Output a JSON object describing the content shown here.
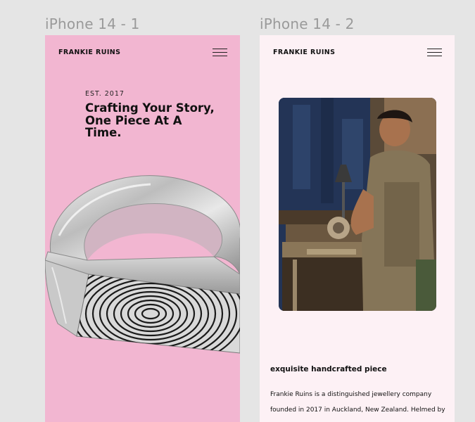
{
  "frames": [
    {
      "label": "iPhone 14 - 1",
      "background": "#f2b6d1",
      "brand": "FRANKIE RUINS",
      "est": "EST. 2017",
      "title_lines": [
        "Crafting Your Story,",
        "One Piece At A",
        "Time."
      ]
    },
    {
      "label": "iPhone 14 - 2",
      "background": "#fdf1f5",
      "brand": "FRANKIE RUINS",
      "subheading": "exquisite handcrafted piece",
      "body_lines": [
        "Frankie Ruins is a distinguished jewellery company",
        "founded in 2017 in Auckland, New Zealand. Helmed by"
      ]
    }
  ],
  "icons": {
    "menu": "hamburger-menu-icon",
    "ring": "fingerprint-ring-image",
    "photo": "jeweller-workshop-photo"
  }
}
